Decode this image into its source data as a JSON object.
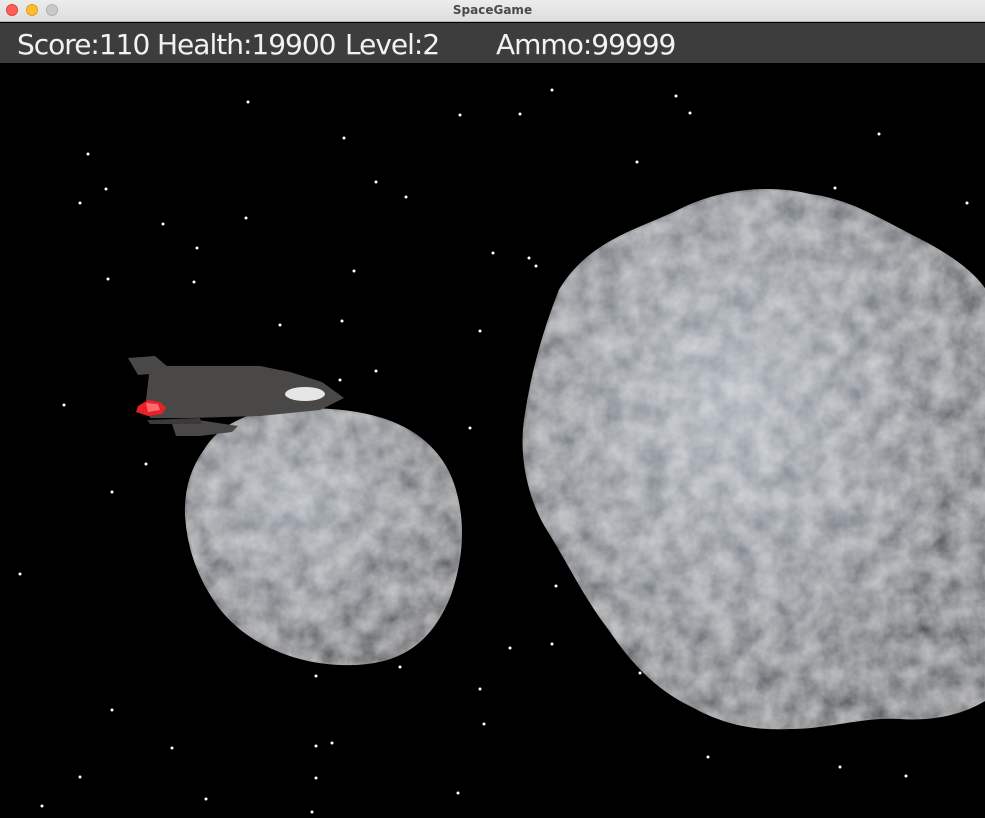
{
  "window": {
    "title": "SpaceGame"
  },
  "hud": {
    "score_text": "Score:110",
    "health_text": "Health:19900",
    "level_text": "Level:2",
    "ammo_text": "Ammo:99999"
  },
  "colors": {
    "background": "#000000",
    "hud_bar": "#3d3d3d",
    "hud_text": "#f2f2f2",
    "ship_body": "#4a4747",
    "ship_flame": "#e8202a",
    "asteroid": "#7a8088"
  }
}
